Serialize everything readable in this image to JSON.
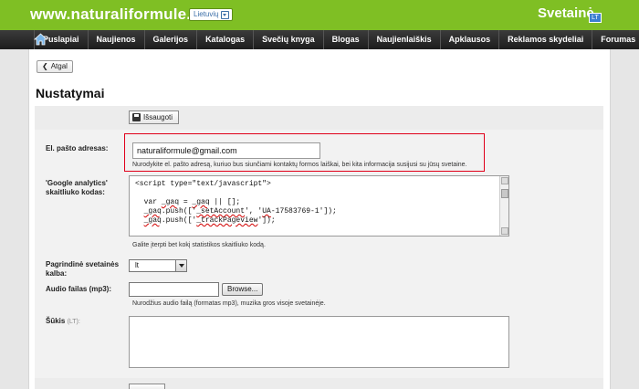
{
  "header": {
    "site_title": "www.naturaliformule.lt",
    "language": "Lietuvių",
    "brand": "Svetainė",
    "brand_badge": "LT"
  },
  "nav": {
    "items": [
      "Puslapiai",
      "Naujienos",
      "Galerijos",
      "Katalogas",
      "Svečių knyga",
      "Blogas",
      "Naujienlaiškis",
      "Apklausos",
      "Reklamos skydeliai",
      "Forumas"
    ]
  },
  "page": {
    "back_label": "Atgal",
    "title": "Nustatymai",
    "save_label": "Išsaugoti"
  },
  "form": {
    "email": {
      "label": "El. pašto adresas:",
      "value": "naturaliformule@gmail.com",
      "hint": "Nurodykite el. pašto adresą, kuriuo bus siunčiami kontaktų formos laiškai, bei kita informacija susijusi su jūsų svetaine."
    },
    "analytics": {
      "label_line1": "'Google analytics'",
      "label_line2": "skaitliuko kodas:",
      "code_lines": [
        "<script type=\"text/javascript\">",
        "",
        "  var _gaq = _gaq || [];",
        "  _gaq.push(['_setAccount', 'UA-17583769-1']);",
        "  _gaq.push(['_trackPageview']);"
      ],
      "hint": "Galite įterpti bet kokį statistikos skaitliuko kodą."
    },
    "language": {
      "label_line1": "Pagrindinė svetainės",
      "label_line2": "kalba:",
      "value": "lt"
    },
    "audio": {
      "label": "Audio failas (mp3):",
      "browse_label": "Browse...",
      "hint": "Nurodžius audio failą (formatas mp3), muzika gros visoje svetainėje."
    },
    "slogan": {
      "label": "Šūkis",
      "lang_tag": "(LT):"
    }
  },
  "colors": {
    "header_green": "#7fbf24",
    "nav_dark": "#1d1d1d",
    "highlight_red": "#e0001a"
  }
}
